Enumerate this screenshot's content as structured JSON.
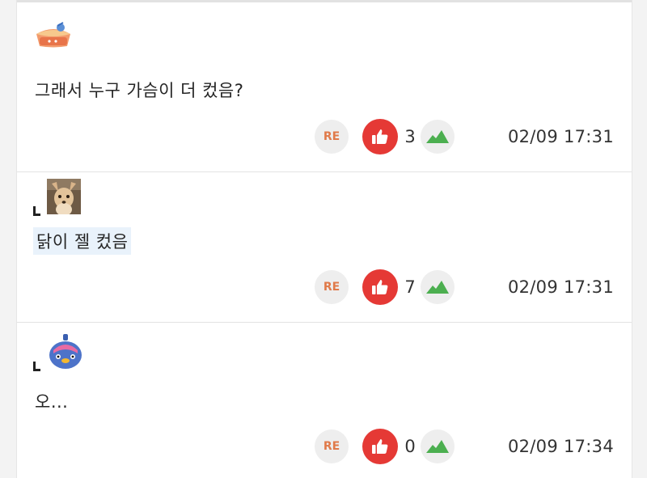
{
  "comments": [
    {
      "avatar_icon": "pie-avatar-icon",
      "is_reply": false,
      "text": "그래서 누구 가슴이 더 컸음?",
      "re_label": "RE",
      "likes": "3",
      "time": "02/09 17:31"
    },
    {
      "avatar_icon": "dog-photo-avatar",
      "is_reply": true,
      "text": "닭이 젤 컸음",
      "re_label": "RE",
      "likes": "7",
      "time": "02/09 17:31"
    },
    {
      "avatar_icon": "blue-bird-avatar-icon",
      "is_reply": true,
      "text": "오...",
      "re_label": "RE",
      "likes": "0",
      "time": "02/09 17:34"
    }
  ],
  "colors": {
    "like": "#e53935",
    "re_text": "#e07a4a",
    "graph": "#4caf50",
    "highlight": "#e9f2fb"
  }
}
